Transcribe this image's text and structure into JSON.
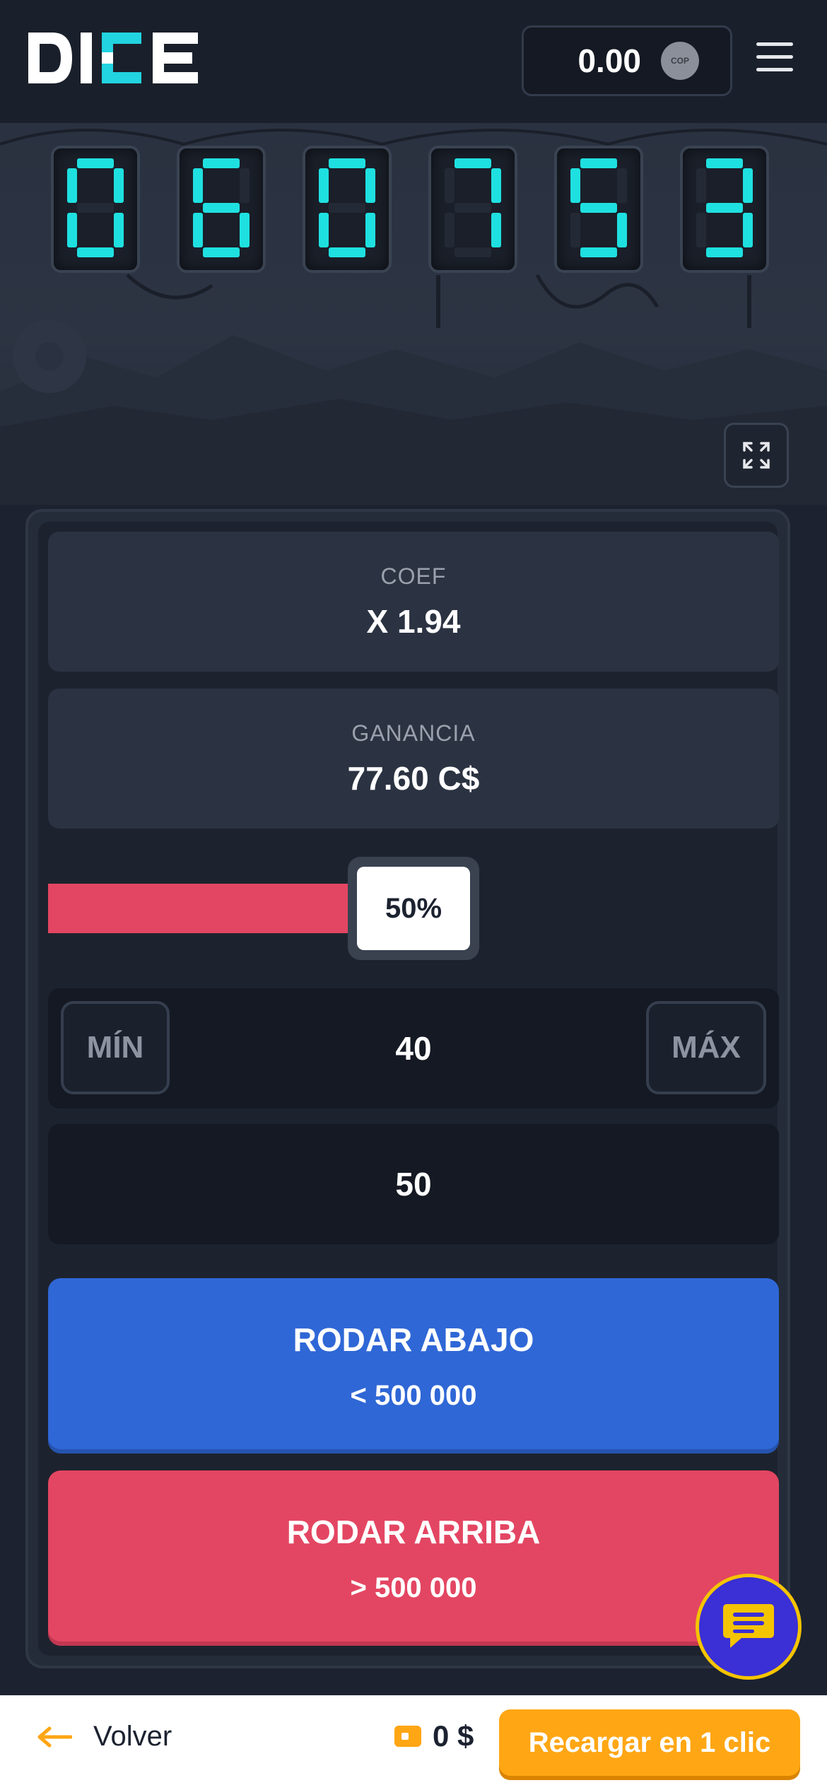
{
  "header": {
    "logo_text": "DICE",
    "balance": "0.00",
    "currency_code": "COP"
  },
  "game": {
    "digits": [
      "0",
      "6",
      "0",
      "7",
      "5",
      "3"
    ],
    "digit_color": "#1fe0e0"
  },
  "coef": {
    "label": "COEF",
    "value": "X 1.94"
  },
  "profit": {
    "label": "GANANCIA",
    "value": "77.60 C$"
  },
  "slider": {
    "percent_label": "50%",
    "fraction": 0.5
  },
  "range": {
    "min_label": "MÍN",
    "max_label": "MÁX",
    "value": "40"
  },
  "target": {
    "value": "50"
  },
  "roll_down": {
    "title": "RODAR ABAJO",
    "subtitle": "< 500 000"
  },
  "roll_up": {
    "title": "RODAR ARRIBA",
    "subtitle": "> 500 000"
  },
  "bottom": {
    "back_label": "Volver",
    "bonus_value": "0 $",
    "recharge_label": "Recargar en 1 clic"
  },
  "colors": {
    "blue": "#2f67d6",
    "red": "#e34662",
    "orange": "#ffa614",
    "background": "#1c2230"
  }
}
